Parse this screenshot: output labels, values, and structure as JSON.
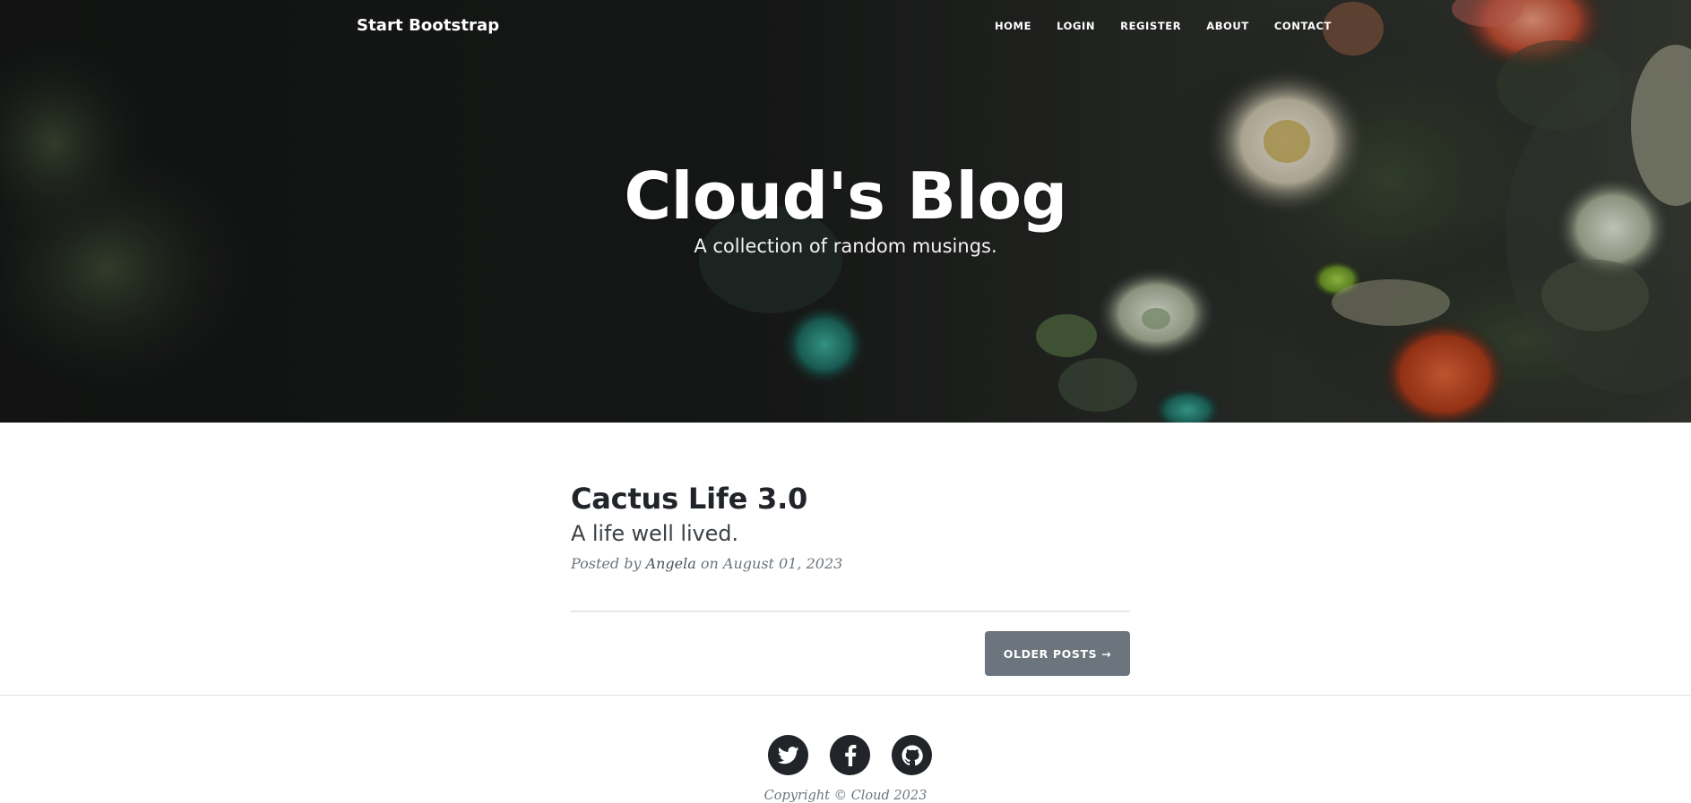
{
  "navbar": {
    "brand": "Start Bootstrap",
    "links": [
      {
        "label": "Home"
      },
      {
        "label": "Login"
      },
      {
        "label": "Register"
      },
      {
        "label": "About"
      },
      {
        "label": "Contact"
      }
    ]
  },
  "hero": {
    "title": "Cloud's Blog",
    "subtitle": "A collection of random musings."
  },
  "posts": [
    {
      "title": "Cactus Life 3.0",
      "subtitle": "A life well lived.",
      "meta_prefix": "Posted by",
      "author": "Angela",
      "meta_on": "on",
      "date": "August 01, 2023"
    }
  ],
  "pager": {
    "older_label": "Older Posts →"
  },
  "footer": {
    "social": [
      {
        "icon": "twitter-icon"
      },
      {
        "icon": "facebook-icon"
      },
      {
        "icon": "github-icon"
      }
    ],
    "copyright": "Copyright © Cloud 2023"
  },
  "colors": {
    "button": "#6c757d",
    "social_circle": "#212529",
    "heading_text": "#212529",
    "meta_text": "#6c757d"
  }
}
